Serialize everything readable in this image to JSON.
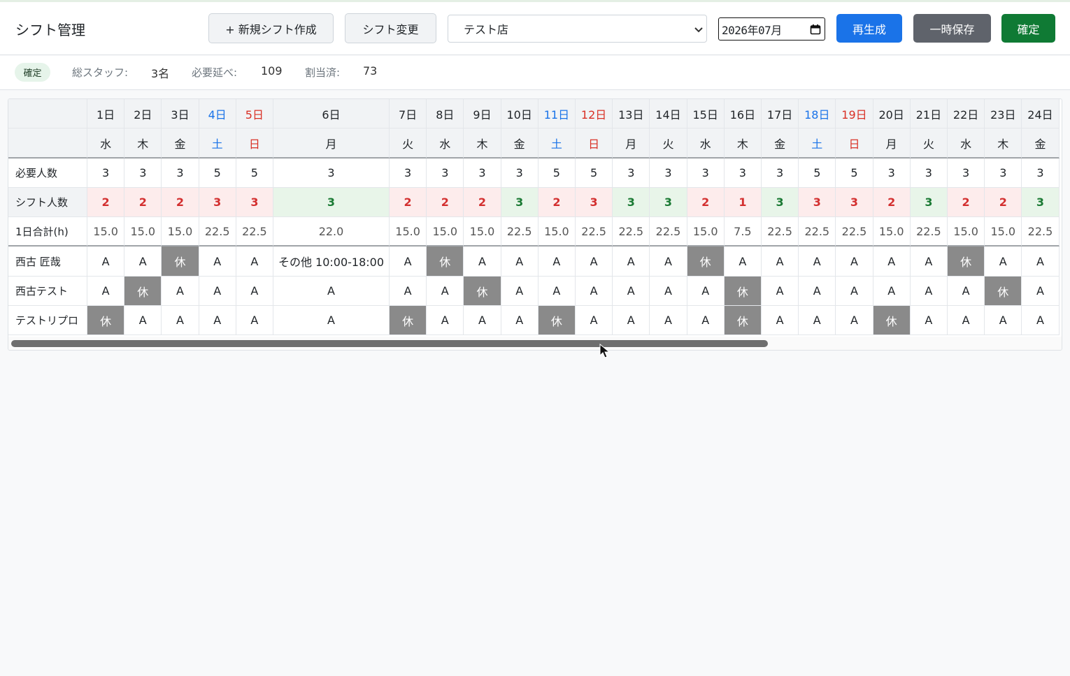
{
  "app": {
    "title": "シフト管理"
  },
  "toolbar": {
    "new_shift_label": "+ 新規シフト作成",
    "change_shift_label": "シフト変更",
    "store_selected": "テスト店",
    "month_value": "2026年07月",
    "regenerate_label": "再生成",
    "temp_save_label": "一時保存",
    "confirm_label": "確定"
  },
  "summary": {
    "status_badge": "確定",
    "total_staff_label": "総スタッフ:",
    "total_staff_value": "3名",
    "required_label": "必要延べ:",
    "required_value": "109",
    "assigned_label": "割当済:",
    "assigned_value": "73"
  },
  "grid": {
    "row_labels": {
      "required": "必要人数",
      "shift_count": "シフト人数",
      "daily_total": "1日合計(h)"
    },
    "days": [
      {
        "date": "1日",
        "weekday": "水",
        "type": "weekday",
        "required": "3",
        "shift_count": "2",
        "status": "short",
        "hours": "15.0"
      },
      {
        "date": "2日",
        "weekday": "木",
        "type": "weekday",
        "required": "3",
        "shift_count": "2",
        "status": "short",
        "hours": "15.0"
      },
      {
        "date": "3日",
        "weekday": "金",
        "type": "weekday",
        "required": "3",
        "shift_count": "2",
        "status": "short",
        "hours": "15.0"
      },
      {
        "date": "4日",
        "weekday": "土",
        "type": "sat",
        "required": "5",
        "shift_count": "3",
        "status": "short",
        "hours": "22.5"
      },
      {
        "date": "5日",
        "weekday": "日",
        "type": "sun",
        "required": "5",
        "shift_count": "3",
        "status": "short",
        "hours": "22.5"
      },
      {
        "date": "6日",
        "weekday": "月",
        "type": "weekday",
        "required": "3",
        "shift_count": "3",
        "status": "ok",
        "hours": "22.0",
        "wide": true
      },
      {
        "date": "7日",
        "weekday": "火",
        "type": "weekday",
        "required": "3",
        "shift_count": "2",
        "status": "short",
        "hours": "15.0"
      },
      {
        "date": "8日",
        "weekday": "水",
        "type": "weekday",
        "required": "3",
        "shift_count": "2",
        "status": "short",
        "hours": "15.0"
      },
      {
        "date": "9日",
        "weekday": "木",
        "type": "weekday",
        "required": "3",
        "shift_count": "2",
        "status": "short",
        "hours": "15.0"
      },
      {
        "date": "10日",
        "weekday": "金",
        "type": "weekday",
        "required": "3",
        "shift_count": "3",
        "status": "ok",
        "hours": "22.5"
      },
      {
        "date": "11日",
        "weekday": "土",
        "type": "sat",
        "required": "5",
        "shift_count": "2",
        "status": "short",
        "hours": "15.0"
      },
      {
        "date": "12日",
        "weekday": "日",
        "type": "sun",
        "required": "5",
        "shift_count": "3",
        "status": "short",
        "hours": "22.5"
      },
      {
        "date": "13日",
        "weekday": "月",
        "type": "weekday",
        "required": "3",
        "shift_count": "3",
        "status": "ok",
        "hours": "22.5"
      },
      {
        "date": "14日",
        "weekday": "火",
        "type": "weekday",
        "required": "3",
        "shift_count": "3",
        "status": "ok",
        "hours": "22.5"
      },
      {
        "date": "15日",
        "weekday": "水",
        "type": "weekday",
        "required": "3",
        "shift_count": "2",
        "status": "short",
        "hours": "15.0"
      },
      {
        "date": "16日",
        "weekday": "木",
        "type": "weekday",
        "required": "3",
        "shift_count": "1",
        "status": "short",
        "hours": "7.5"
      },
      {
        "date": "17日",
        "weekday": "金",
        "type": "weekday",
        "required": "3",
        "shift_count": "3",
        "status": "ok",
        "hours": "22.5"
      },
      {
        "date": "18日",
        "weekday": "土",
        "type": "sat",
        "required": "5",
        "shift_count": "3",
        "status": "short",
        "hours": "22.5"
      },
      {
        "date": "19日",
        "weekday": "日",
        "type": "sun",
        "required": "5",
        "shift_count": "3",
        "status": "short",
        "hours": "22.5"
      },
      {
        "date": "20日",
        "weekday": "月",
        "type": "weekday",
        "required": "3",
        "shift_count": "2",
        "status": "short",
        "hours": "15.0"
      },
      {
        "date": "21日",
        "weekday": "火",
        "type": "weekday",
        "required": "3",
        "shift_count": "3",
        "status": "ok",
        "hours": "22.5"
      },
      {
        "date": "22日",
        "weekday": "水",
        "type": "weekday",
        "required": "3",
        "shift_count": "2",
        "status": "short",
        "hours": "15.0"
      },
      {
        "date": "23日",
        "weekday": "木",
        "type": "weekday",
        "required": "3",
        "shift_count": "2",
        "status": "short",
        "hours": "15.0"
      },
      {
        "date": "24日",
        "weekday": "金",
        "type": "weekday",
        "required": "3",
        "shift_count": "3",
        "status": "ok",
        "hours": "22.5"
      }
    ],
    "staff": [
      {
        "name": "西古 匠哉",
        "shifts": [
          "A",
          "A",
          "休",
          "A",
          "A",
          "その他 10:00-18:00",
          "A",
          "休",
          "A",
          "A",
          "A",
          "A",
          "A",
          "A",
          "休",
          "A",
          "A",
          "A",
          "A",
          "A",
          "A",
          "休",
          "A",
          "A"
        ]
      },
      {
        "name": "西古テスト",
        "shifts": [
          "A",
          "休",
          "A",
          "A",
          "A",
          "A",
          "A",
          "A",
          "休",
          "A",
          "A",
          "A",
          "A",
          "A",
          "A",
          "休",
          "A",
          "A",
          "A",
          "A",
          "A",
          "A",
          "休",
          "A"
        ]
      },
      {
        "name": "テストリプロ",
        "shifts": [
          "休",
          "A",
          "A",
          "A",
          "A",
          "A",
          "休",
          "A",
          "A",
          "A",
          "休",
          "A",
          "A",
          "A",
          "A",
          "休",
          "A",
          "A",
          "A",
          "休",
          "A",
          "A",
          "A",
          "A"
        ]
      }
    ],
    "off_marker": "休",
    "off_cells_shaded": [
      "西古 匠哉:3日",
      "西古 匠哉:15日",
      "西古 匠哉:22日",
      "西古テスト:2日",
      "西古テスト:9日",
      "西古テスト:16日",
      "西古テスト:23日",
      "テストリプロ:1日",
      "テストリプロ:7日",
      "テストリプロ:11日",
      "テストリプロ:16日",
      "テストリプロ:20日"
    ],
    "scrollbar_position": 0.0
  },
  "colors": {
    "primary": "#1a73e8",
    "secondary": "#5f636b",
    "success": "#0f7a34",
    "short": "#d32f2f",
    "ok": "#1b7a34",
    "off": "#8a8a8a"
  }
}
